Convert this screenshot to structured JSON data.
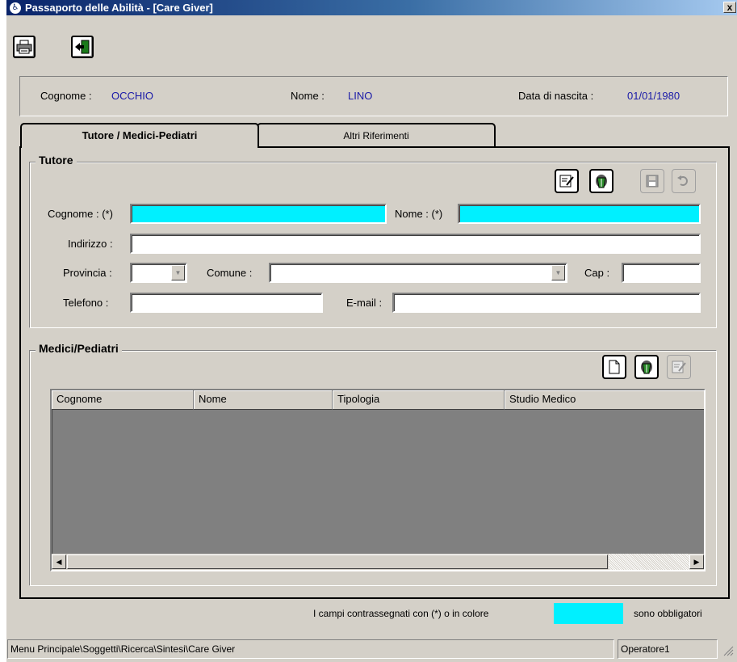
{
  "window": {
    "title": "Passaporto delle Abilità - [Care Giver]",
    "close_label": "x"
  },
  "toolbar": {
    "print_icon": "printer-icon",
    "exit_icon": "exit-door-icon"
  },
  "patient": {
    "surname_label": "Cognome :",
    "surname_value": "OCCHIO",
    "name_label": "Nome :",
    "name_value": "LINO",
    "birth_label": "Data di nascita :",
    "birth_value": "01/01/1980"
  },
  "tabs": [
    {
      "label": "Tutore / Medici-Pediatri",
      "active": true
    },
    {
      "label": "Altri Riferimenti",
      "active": false
    }
  ],
  "tutore": {
    "title": "Tutore",
    "surname_label": "Cognome : (*)",
    "surname_value": "",
    "name_label": "Nome : (*)",
    "name_value": "",
    "address_label": "Indirizzo :",
    "address_value": "",
    "province_label": "Provincia :",
    "province_value": "",
    "city_label": "Comune :",
    "city_value": "",
    "cap_label": "Cap :",
    "cap_value": "",
    "phone_label": "Telefono :",
    "phone_value": "",
    "email_label": "E-mail :",
    "email_value": ""
  },
  "medici": {
    "title": "Medici/Pediatri",
    "columns": [
      "Cognome",
      "Nome",
      "Tipologia",
      "Studio Medico"
    ],
    "rows": []
  },
  "legend": {
    "text_before": "I campi contrassegnati con (*) o in colore",
    "text_after": "sono obbligatori",
    "required_color": "#00f0ff"
  },
  "status": {
    "path": "Menu Principale\\Soggetti\\Ricerca\\Sintesi\\Care Giver",
    "operator": "Operatore1"
  }
}
